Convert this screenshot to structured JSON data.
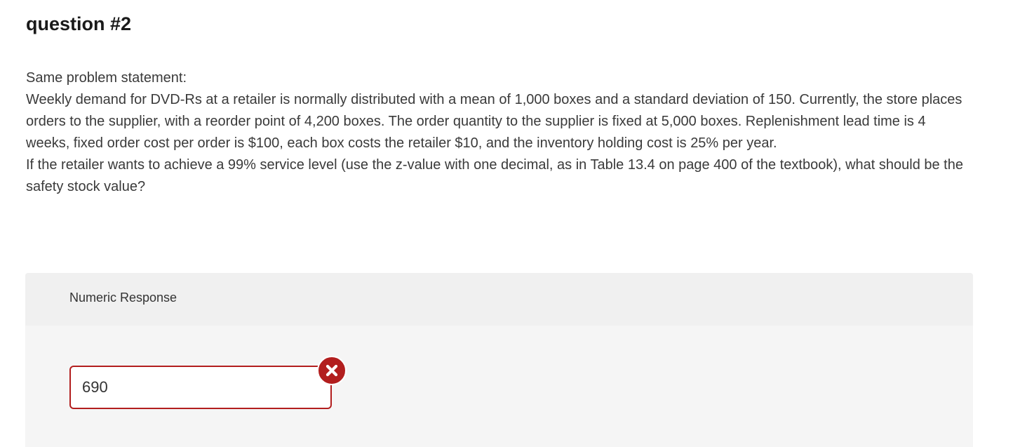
{
  "question": {
    "title": "question #2",
    "lines": [
      "Same problem statement:",
      "Weekly demand for DVD-Rs at a retailer is normally distributed with a mean of 1,000 boxes and a standard deviation of 150. Currently, the store places orders to the supplier, with a reorder point of 4,200 boxes. The order quantity to the supplier is fixed at 5,000 boxes. Replenishment lead time is 4 weeks, fixed order cost per order is $100, each box costs the retailer $10, and the inventory holding cost is 25% per year.",
      "If the retailer wants to achieve a 99% service level (use the z-value with one decimal, as in Table 13.4 on page 400 of the textbook), what should be the safety stock value?"
    ]
  },
  "response": {
    "label": "Numeric Response",
    "value": "690",
    "status_icon": "incorrect-x-icon",
    "status_color": "#b21e1e"
  }
}
